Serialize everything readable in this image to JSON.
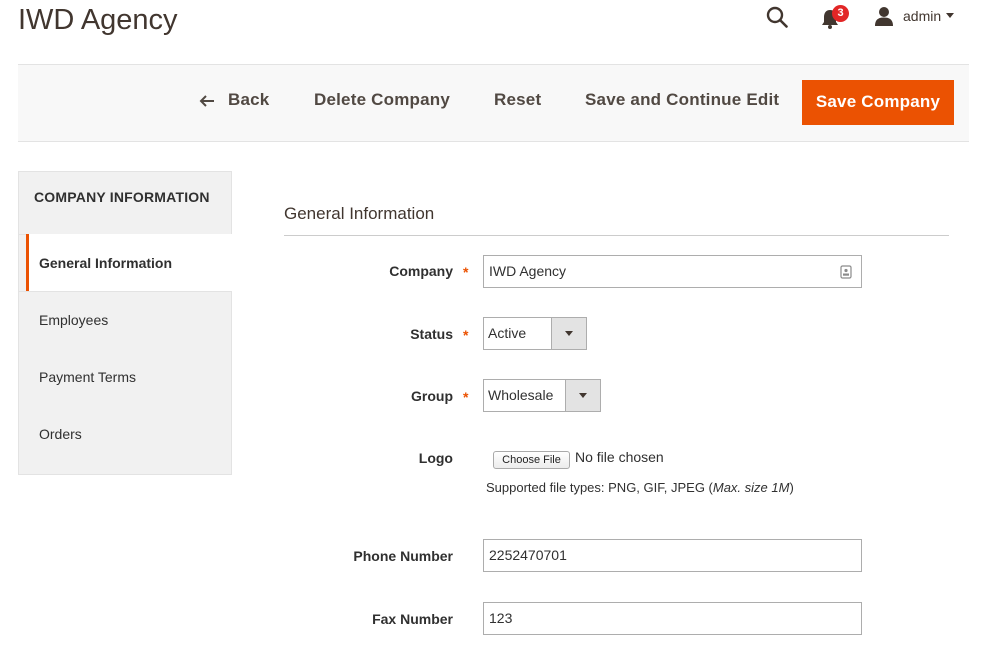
{
  "header": {
    "title": "IWD Agency",
    "notifications_count": "3",
    "user_label": "admin"
  },
  "actions": {
    "back": "Back",
    "delete": "Delete Company",
    "reset": "Reset",
    "save_continue": "Save and Continue Edit",
    "save": "Save Company"
  },
  "sidebar": {
    "title": "COMPANY INFORMATION",
    "items": [
      {
        "label": "General Information",
        "active": true
      },
      {
        "label": "Employees",
        "active": false
      },
      {
        "label": "Payment Terms",
        "active": false
      },
      {
        "label": "Orders",
        "active": false
      }
    ]
  },
  "form": {
    "section_title": "General Information",
    "company": {
      "label": "Company",
      "value": "IWD Agency"
    },
    "status": {
      "label": "Status",
      "value": "Active"
    },
    "group": {
      "label": "Group",
      "value": "Wholesale"
    },
    "logo": {
      "label": "Logo",
      "button": "Choose File",
      "no_file": "No file chosen",
      "supported_prefix": "Supported file types: PNG, GIF, JPEG (",
      "supported_max": "Max. size 1M",
      "supported_suffix": ")"
    },
    "phone": {
      "label": "Phone Number",
      "value": "2252470701"
    },
    "fax": {
      "label": "Fax Number",
      "value": "123"
    },
    "required_mark": "*"
  },
  "colors": {
    "accent": "#eb5202",
    "badge": "#e22626",
    "text": "#303030"
  },
  "icons": [
    "search-icon",
    "bell-icon",
    "user-icon",
    "caret-down-icon",
    "arrow-left-icon",
    "contact-card-icon",
    "chevron-down-icon"
  ]
}
